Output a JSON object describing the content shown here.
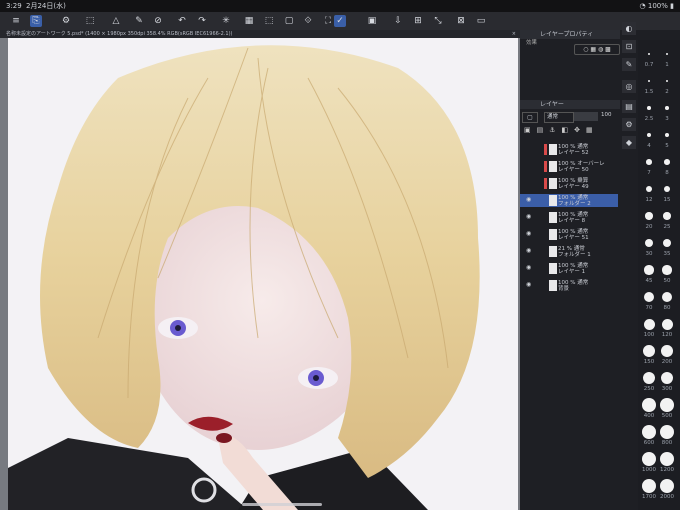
{
  "status_bar": {
    "time": "3:29",
    "date": "2月24日(水)",
    "battery": "100%"
  },
  "doc_tab": {
    "title": "名称未設定のアートワーク 5.psd* (1400 × 1980px 350dpi 358.4%  RGB(sRGB IEC61966-2.1))",
    "close": "×"
  },
  "toolbar": {
    "icons": [
      "≡",
      "⎘",
      "⚙",
      "⬚",
      "△",
      "✎",
      "⊘",
      "↶",
      "↷",
      "✳",
      "▦",
      "⬚",
      "▢",
      "⟐",
      "⛶",
      "⇩",
      "▣",
      "⊞",
      "⤡",
      "⊠",
      "▭"
    ]
  },
  "panels": {
    "layer_property": "レイヤープロパティ",
    "effect": "効果",
    "layer": "レイヤー",
    "blend_mode": "通常",
    "opacity_value": "100"
  },
  "layers": [
    {
      "line1": "100 % 通常",
      "line2": "レイヤー 52",
      "marker": true,
      "sel": false,
      "eye": false
    },
    {
      "line1": "100 % オーバーレ",
      "line2": "レイヤー 50",
      "marker": true,
      "sel": false,
      "eye": false
    },
    {
      "line1": "100 % 乗算",
      "line2": "レイヤー 49",
      "marker": true,
      "sel": false,
      "eye": false
    },
    {
      "line1": "100 % 通常",
      "line2": "フォルダー 2",
      "marker": false,
      "sel": true,
      "eye": true
    },
    {
      "line1": "100 % 通常",
      "line2": "レイヤー 8",
      "marker": false,
      "sel": false,
      "eye": true
    },
    {
      "line1": "100 % 通常",
      "line2": "レイヤー 51",
      "marker": false,
      "sel": false,
      "eye": true
    },
    {
      "line1": "21 % 通常",
      "line2": "フォルダー 1",
      "marker": false,
      "sel": false,
      "eye": true
    },
    {
      "line1": "100 % 通常",
      "line2": "レイヤー 1",
      "marker": false,
      "sel": false,
      "eye": true
    },
    {
      "line1": "100 % 通常",
      "line2": "背景",
      "marker": false,
      "sel": false,
      "eye": true
    }
  ],
  "brush_sizes": {
    "left": [
      "0.7",
      "1.5",
      "2.5",
      "4",
      "7",
      "12",
      "20",
      "30",
      "45",
      "70",
      "100",
      "150",
      "250",
      "400",
      "600",
      "1000",
      "1700"
    ],
    "right": [
      "1",
      "2",
      "3",
      "5",
      "8",
      "15",
      "25",
      "35",
      "50",
      "80",
      "120",
      "200",
      "300",
      "500",
      "800",
      "1200",
      "2000"
    ]
  },
  "colors": {
    "accent": "#3b5ea8",
    "hair": "#e9d7a5",
    "skin": "#f3e2df",
    "lips": "#9b1f2a"
  }
}
